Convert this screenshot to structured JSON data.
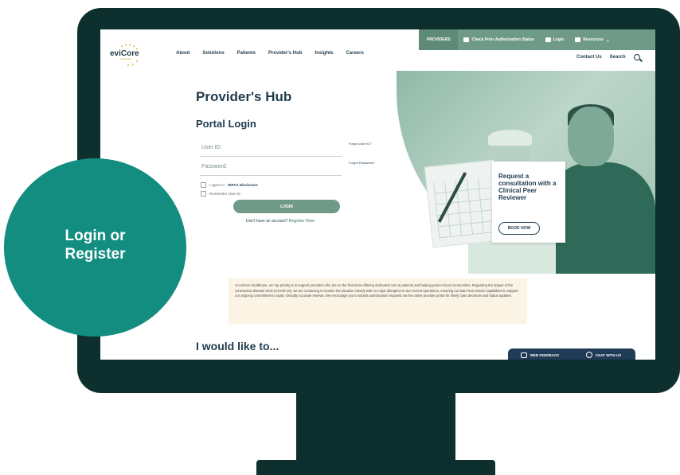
{
  "top_bar": {
    "providers": "PROVIDERS",
    "check_status": "Check Prior Authorization Status",
    "login": "Login",
    "resources": "Resources"
  },
  "logo": {
    "name": "eviCore",
    "sub": "healthcare"
  },
  "nav": {
    "about": "About",
    "solutions": "Solutions",
    "patients": "Patients",
    "providers_hub": "Provider's Hub",
    "insights": "Insights",
    "careers": "Careers"
  },
  "utility": {
    "contact": "Contact Us",
    "search": "Search"
  },
  "hub": {
    "title": "Provider's Hub",
    "portal_title": "Portal Login",
    "userid_placeholder": "User ID",
    "password_placeholder": "Password",
    "forgot_userid": "Forgot User ID?",
    "forgot_password": "Forgot Password?",
    "agree_prefix": "I agree to",
    "agree_link": "HIPAA Disclosure",
    "remember": "Remember User ID",
    "login_button": "LOGIN",
    "no_account": "Don't have an account?",
    "register_now": "Register Now"
  },
  "consult": {
    "text": "Request a consultation with a Clinical Peer Reviewer",
    "button": "BOOK NOW"
  },
  "notice": "At eviCore healthcare, our top priority is to support providers who are on the front lines offering dedicated care to patients and helping protect local communities. Regarding the impact of the coronavirus disease 2019 (COVID-19), we are continuing to monitor the situation closely with no major disruption to our current operations, ensuring our team has remote capabilities to support our ongoing commitment to rapid, clinically accurate reviews. We encourage you to submit authorization requests via the online provider portal for timely case decisions and status updates.",
  "would_like": "I would like to...",
  "feedback": {
    "web_feedback": "WEB FEEDBACK",
    "chat": "CHAT WITH US"
  },
  "badge": {
    "line1": "Login or",
    "line2": "Register"
  },
  "colors": {
    "frame": "#0d2f2e",
    "accent": "#6f9a87",
    "badge": "#128d80",
    "navy": "#1f3b4d"
  }
}
